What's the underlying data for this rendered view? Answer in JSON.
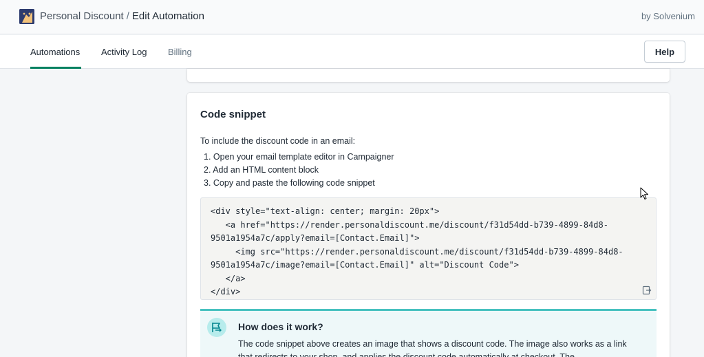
{
  "header": {
    "app_name": "Personal Discount",
    "separator": "/",
    "page_title": "Edit Automation",
    "vendor": "by Solvenium"
  },
  "tabs": [
    {
      "label": "Automations",
      "active": true
    },
    {
      "label": "Activity Log",
      "active": false
    },
    {
      "label": "Billing",
      "active": false
    }
  ],
  "help_label": "Help",
  "code_card": {
    "title": "Code snippet",
    "intro": "To include the discount code in an email:",
    "steps": [
      "1. Open your email template editor in Campaigner",
      "2. Add an HTML content block",
      "3. Copy and paste the following code snippet"
    ],
    "code": "<div style=\"text-align: center; margin: 20px\">\n   <a href=\"https://render.personaldiscount.me/discount/f31d54dd-b739-4899-84d8-\n9501a1954a7c/apply?email=[Contact.Email]\">\n     <img src=\"https://render.personaldiscount.me/discount/f31d54dd-b739-4899-84d8-\n9501a1954a7c/image?email=[Contact.Email]\" alt=\"Discount Code\">\n   </a>\n</div>",
    "copy_icon": "copy-icon"
  },
  "info_banner": {
    "title": "How does it work?",
    "body": "The code snippet above creates an image that shows a discount code. The image also works as a link that redirects to your shop, and applies the discount code automatically at checkout. The",
    "icon": "flag-icon"
  },
  "colors": {
    "accent": "#008060",
    "banner_border": "#47c1bf",
    "banner_bg": "#eef8f9"
  }
}
